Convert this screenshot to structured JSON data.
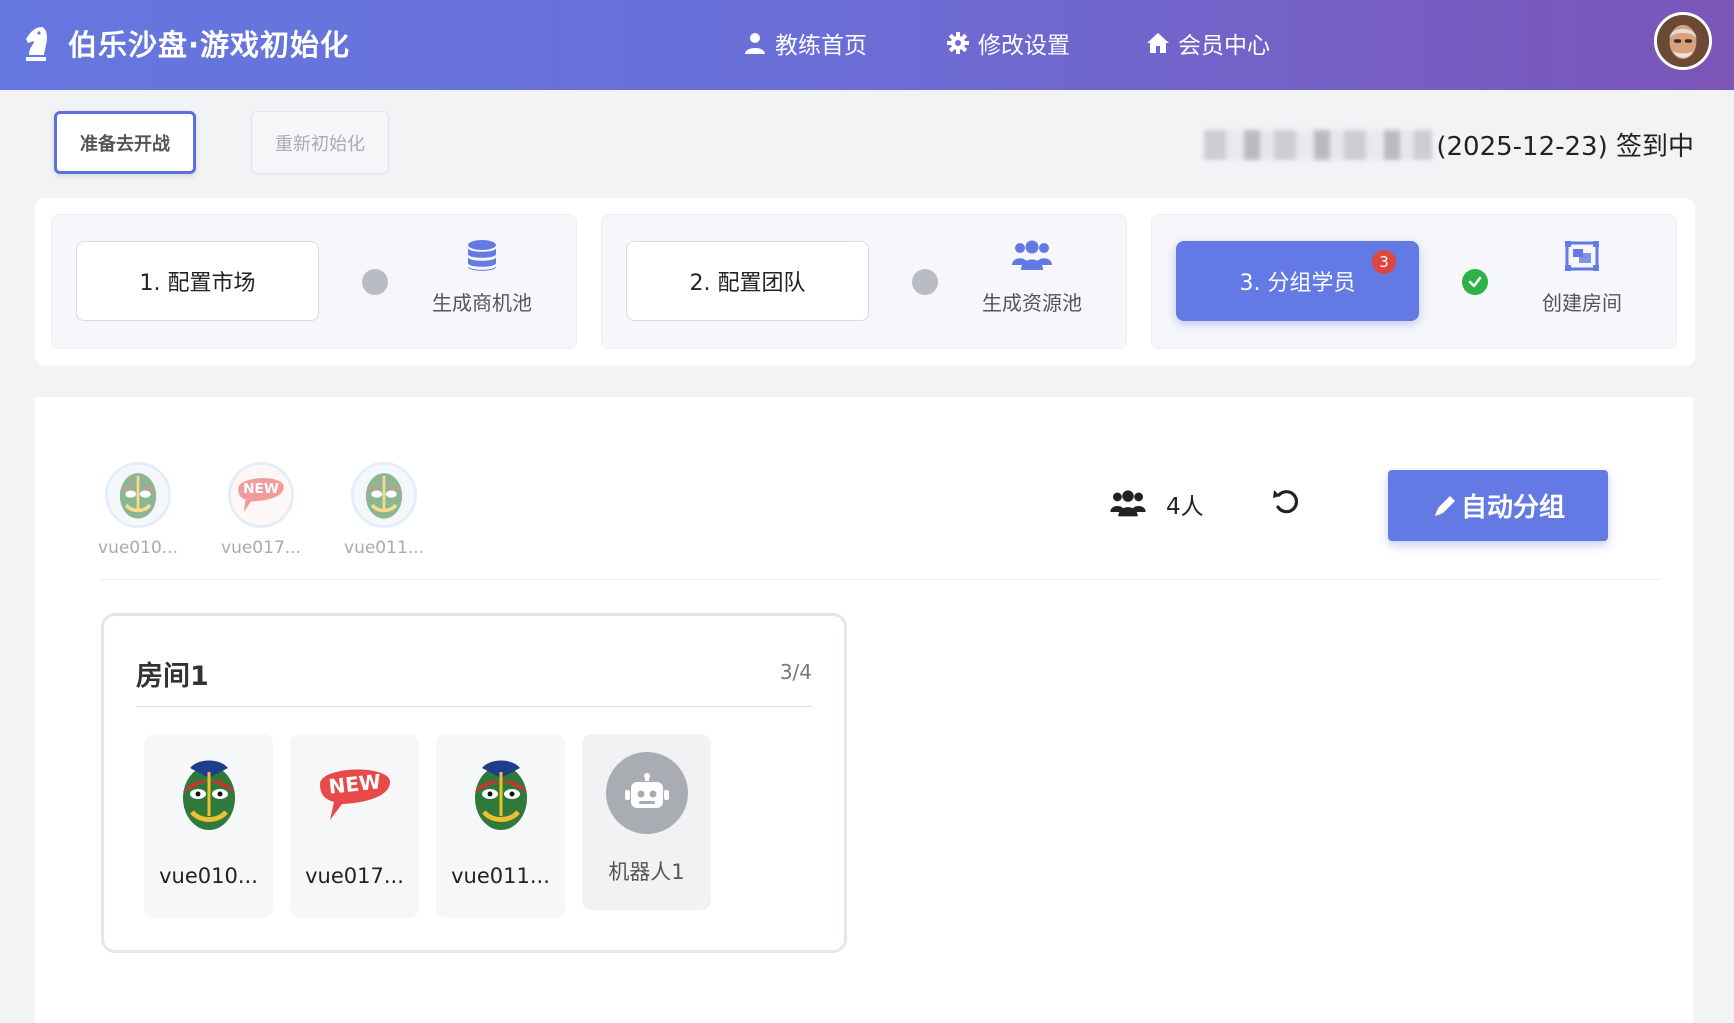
{
  "header": {
    "brand_title": "伯乐沙盘·游戏初始化",
    "nav": [
      {
        "label": "教练首页",
        "icon": "user-icon"
      },
      {
        "label": "修改设置",
        "icon": "gear-icon"
      },
      {
        "label": "会员中心",
        "icon": "home-icon"
      }
    ]
  },
  "actions": {
    "ready_label": "准备去开战",
    "reinit_label": "重新初始化"
  },
  "signin": {
    "text": "(2025-12-23) 签到中"
  },
  "steps": [
    {
      "label": "1. 配置市场",
      "status": "pending",
      "result": "生成商机池",
      "result_icon": "database-icon"
    },
    {
      "label": "2. 配置团队",
      "status": "pending",
      "result": "生成资源池",
      "result_icon": "users-icon"
    },
    {
      "label": "3. 分组学员",
      "status": "done",
      "badge": "3",
      "result": "创建房间",
      "result_icon": "room-icon"
    }
  ],
  "members": [
    {
      "name": "vue010...",
      "avatar": "opera-mask"
    },
    {
      "name": "vue017...",
      "avatar": "new-badge"
    },
    {
      "name": "vue011...",
      "avatar": "opera-mask"
    }
  ],
  "group": {
    "count_label": "4人",
    "auto_label": "自动分组"
  },
  "room": {
    "title": "房间1",
    "count": "3/4",
    "seats": [
      {
        "name": "vue010...",
        "avatar": "opera-mask"
      },
      {
        "name": "vue017...",
        "avatar": "new-badge"
      },
      {
        "name": "vue011...",
        "avatar": "opera-mask"
      },
      {
        "name": "机器人1",
        "avatar": "robot"
      }
    ]
  },
  "colors": {
    "accent": "#6379e4",
    "success": "#2fb14a",
    "badge": "#e0463f"
  }
}
